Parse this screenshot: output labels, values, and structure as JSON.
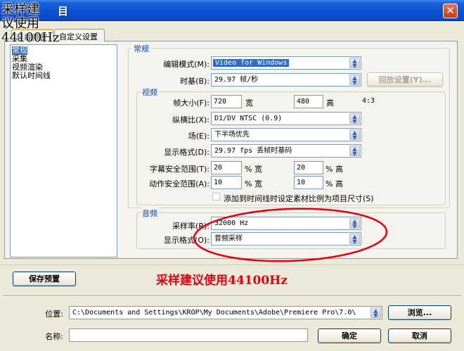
{
  "window": {
    "title": "目",
    "close_symbol": "✕"
  },
  "watermark": {
    "line1": "采样建",
    "line2": "议使用",
    "line3": "44100Hz"
  },
  "tabs": [
    {
      "label": "装载预置"
    },
    {
      "label": "自定义设置"
    }
  ],
  "left_list": {
    "items": [
      "常规",
      "采集",
      "视频渲染",
      "默认时间线"
    ],
    "selected": 0
  },
  "general": {
    "group_label": "常规",
    "edit_mode_label": "编辑模式(M):",
    "edit_mode_value": "Video for Windows",
    "timebase_label": "时基(B):",
    "timebase_value": "29.97 帧/秒",
    "playback_settings_button": "回放设置(Y)..."
  },
  "video": {
    "group_label": "视频",
    "frame_size_label": "帧大小(F):",
    "frame_width": "720",
    "width_label": "宽",
    "frame_height": "480",
    "height_label": "高",
    "aspect_ratio": "4:3",
    "pixel_aspect_label": "纵横比(X):",
    "pixel_aspect_value": "D1/DV NTSC (0.9)",
    "fields_label": "场(E):",
    "fields_value": "下半场优先",
    "display_format_label": "显示格式(D):",
    "display_format_value": "29.97 fps 丢帧时基码",
    "title_safe_label": "字幕安全范围(T):",
    "title_safe_w": "20",
    "title_safe_h": "20",
    "action_safe_label": "动作安全范围(A):",
    "action_safe_w": "10",
    "action_safe_h": "10",
    "pct_width": "% 宽",
    "pct_height": "% 高",
    "scale_checkbox_label": "添加到时间线时设定素材比例为项目尺寸(S)"
  },
  "audio": {
    "group_label": "音频",
    "sample_rate_label": "采样率(R):",
    "sample_rate_value": "32000 Hz",
    "display_format_label": "显示格式(O):",
    "display_format_value": "音频采样"
  },
  "save_preset_button": "保存预置",
  "annotation": "采样建议使用44100Hz",
  "location": {
    "label": "位置:",
    "value": "C:\\Documents and Settings\\KROP\\My Documents\\Adobe\\Premiere Pro\\7.0\\",
    "browse_button": "浏览..."
  },
  "name": {
    "label": "名称:",
    "value": ""
  },
  "ok_button": "确定",
  "cancel_button": "取消",
  "colors": {
    "titlebar": "#0a4fd4",
    "group_label": "#0046d5",
    "annotation": "#e60012",
    "selection": "#316ac5"
  }
}
